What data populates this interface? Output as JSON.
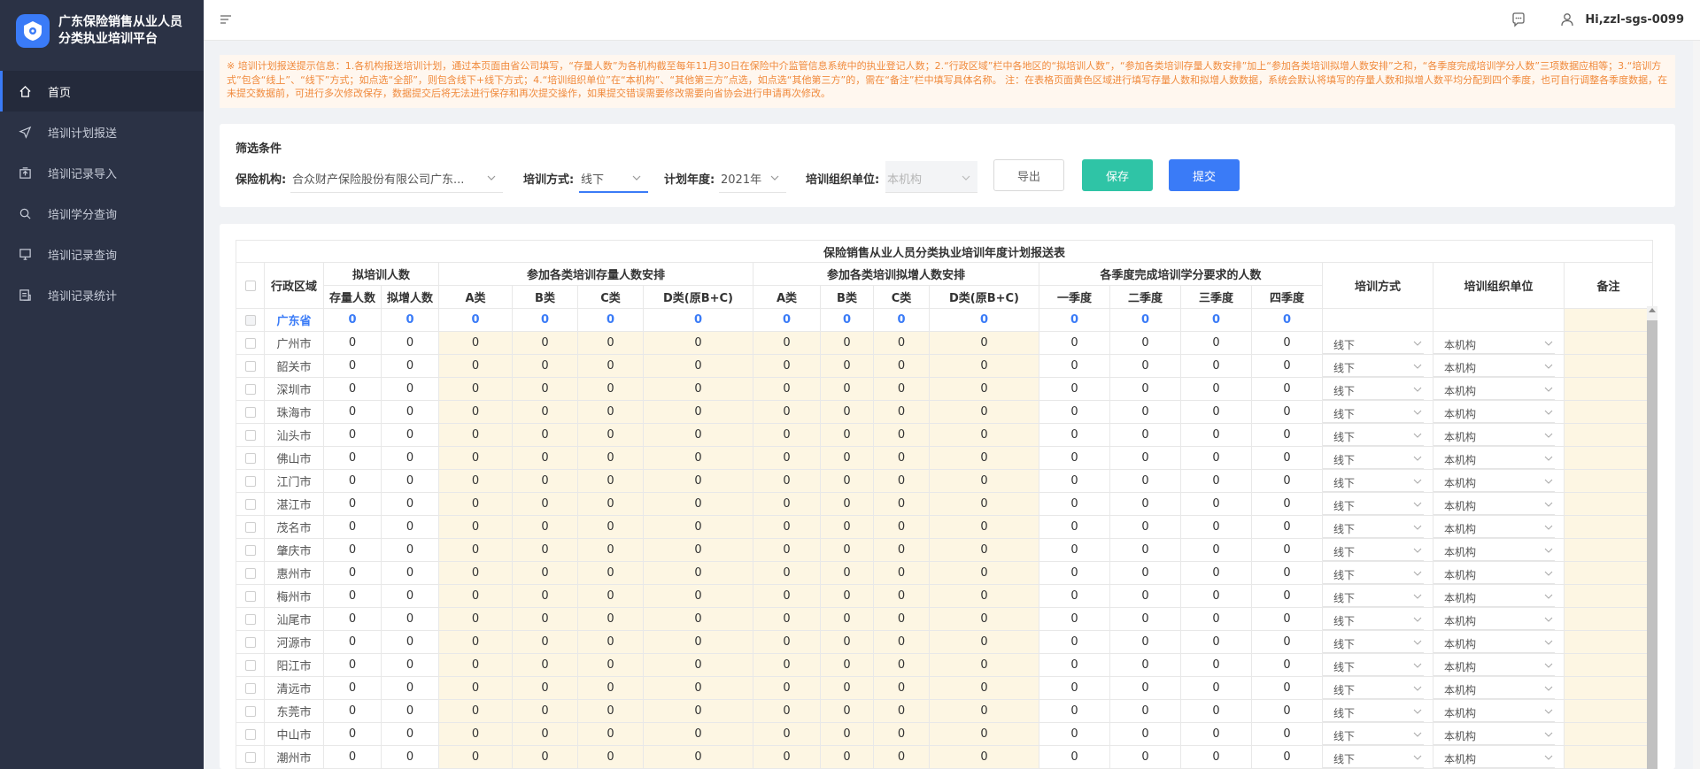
{
  "app": {
    "title_line1": "广东保险销售从业人员",
    "title_line2": "分类执业培训平台"
  },
  "sidebar": {
    "items": [
      {
        "label": "首页",
        "icon": "home-icon",
        "active": true
      },
      {
        "label": "培训计划报送",
        "icon": "send-icon",
        "active": false
      },
      {
        "label": "培训记录导入",
        "icon": "import-icon",
        "active": false
      },
      {
        "label": "培训学分查询",
        "icon": "search-icon",
        "active": false
      },
      {
        "label": "培训记录查询",
        "icon": "monitor-icon",
        "active": false
      },
      {
        "label": "培训记录统计",
        "icon": "report-icon",
        "active": false
      }
    ]
  },
  "header": {
    "user": "Hi,zzl-sgs-0099"
  },
  "notice": {
    "text": "※ 培训计划报送提示信息：1.各机构报送培训计划，通过本页面由省公司填写，“存量人数”为各机构截至每年11月30日在保险中介监管信息系统中的执业登记人数；2.“行政区域”栏中各地区的“拟培训人数”，“参加各类培训存量人数安排”加上“参加各类培训拟增人数安排”之和，“各季度完成培训学分人数”三项数据应相等；3.“培训方式”包含“线上”、“线下”方式；如点选“全部”，则包含线下+线下方式；4.“培训组织单位”在“本机构”、“其他第三方”点选，如点选“其他第三方”的，需在“备注”栏中填写具体名称。 注：在表格页面黄色区域进行填写存量人数和拟增人数数据，系统会默认将填写的存量人数和拟增人数平均分配到四个季度，也可自行调整各季度数据，在未提交数据前，可进行多次修改保存，数据提交后将无法进行保存和再次提交操作，如果提交错误需要修改需要向省协会进行申请再次修改。"
  },
  "filter": {
    "title": "筛选条件",
    "institution_label": "保险机构:",
    "institution_value": "合众财产保险股份有限公司广东...",
    "method_label": "培训方式:",
    "method_value": "线下",
    "year_label": "计划年度:",
    "year_value": "2021年",
    "org_label": "培训组织单位:",
    "org_placeholder": "本机构",
    "export_label": "导出",
    "save_label": "保存",
    "submit_label": "提交"
  },
  "table": {
    "title": "保险销售从业人员分类执业培训年度计划报送表",
    "h_region": "行政区域",
    "h_plan": "拟培训人数",
    "h_stock": "参加各类培训存量人数安排",
    "h_new": "参加各类培训拟增人数安排",
    "h_quarter": "各季度完成培训学分要求的人数",
    "h_method": "培训方式",
    "h_org": "培训组织单位",
    "h_note": "备注",
    "sub_plan": [
      "存量人数",
      "拟增人数"
    ],
    "sub_stock": [
      "A类",
      "B类",
      "C类",
      "D类(原B+C)"
    ],
    "sub_new": [
      "A类",
      "B类",
      "C类",
      "D类(原B+C)"
    ],
    "sub_quarter": [
      "一季度",
      "二季度",
      "三季度",
      "四季度"
    ],
    "province": {
      "region": "广东省",
      "values": [
        "0",
        "0",
        "0",
        "0",
        "0",
        "0",
        "0",
        "0",
        "0",
        "0",
        "0",
        "0",
        "0",
        "0"
      ]
    },
    "rows": [
      {
        "region": "广州市",
        "method": "线下",
        "org": "本机构"
      },
      {
        "region": "韶关市",
        "method": "线下",
        "org": "本机构"
      },
      {
        "region": "深圳市",
        "method": "线下",
        "org": "本机构"
      },
      {
        "region": "珠海市",
        "method": "线下",
        "org": "本机构"
      },
      {
        "region": "汕头市",
        "method": "线下",
        "org": "本机构"
      },
      {
        "region": "佛山市",
        "method": "线下",
        "org": "本机构"
      },
      {
        "region": "江门市",
        "method": "线下",
        "org": "本机构"
      },
      {
        "region": "湛江市",
        "method": "线下",
        "org": "本机构"
      },
      {
        "region": "茂名市",
        "method": "线下",
        "org": "本机构"
      },
      {
        "region": "肇庆市",
        "method": "线下",
        "org": "本机构"
      },
      {
        "region": "惠州市",
        "method": "线下",
        "org": "本机构"
      },
      {
        "region": "梅州市",
        "method": "线下",
        "org": "本机构"
      },
      {
        "region": "汕尾市",
        "method": "线下",
        "org": "本机构"
      },
      {
        "region": "河源市",
        "method": "线下",
        "org": "本机构"
      },
      {
        "region": "阳江市",
        "method": "线下",
        "org": "本机构"
      },
      {
        "region": "清远市",
        "method": "线下",
        "org": "本机构"
      },
      {
        "region": "东莞市",
        "method": "线下",
        "org": "本机构"
      },
      {
        "region": "中山市",
        "method": "线下",
        "org": "本机构"
      },
      {
        "region": "潮州市",
        "method": "线下",
        "org": "本机构"
      }
    ],
    "row_values": [
      "0",
      "0",
      "0",
      "0",
      "0",
      "0",
      "0",
      "0",
      "0",
      "0",
      "0",
      "0",
      "0",
      "0"
    ]
  },
  "colors": {
    "sidebar_bg": "#2b3245",
    "accent": "#3a7bf7",
    "save": "#2fc4a6",
    "notice": "#f08a3c",
    "fill_area": "#fdf6e3"
  }
}
